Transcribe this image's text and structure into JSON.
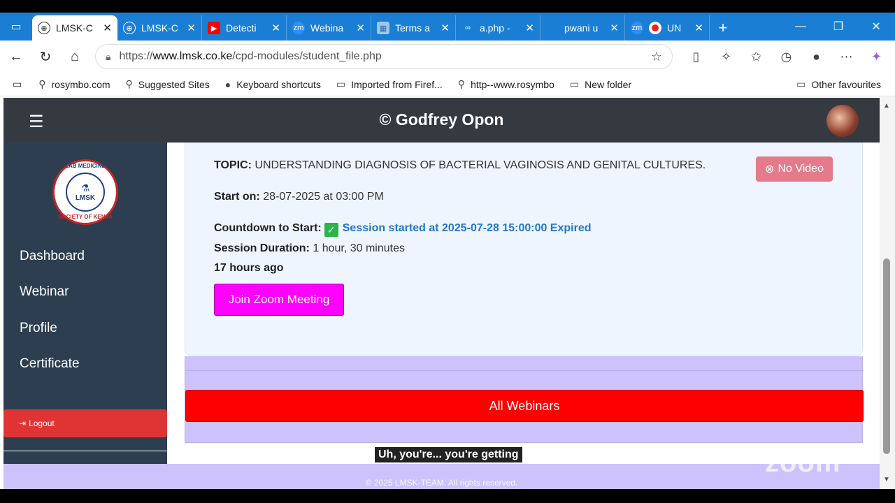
{
  "browser": {
    "tabs": [
      {
        "title": "LMSK-C",
        "active": true
      },
      {
        "title": "LMSK-C"
      },
      {
        "title": "Detecti"
      },
      {
        "title": "Webina"
      },
      {
        "title": "Terms a"
      },
      {
        "title": "a.php -"
      },
      {
        "title": "pwani u"
      },
      {
        "title": "UN"
      }
    ],
    "url_prefix": "https://",
    "url_domain": "www.lmsk.co.ke",
    "url_path": "/cpd-modules/student_file.php",
    "favorites": [
      {
        "label": "rosymbo.com",
        "icon": "search-icon"
      },
      {
        "label": "Suggested Sites",
        "icon": "search-icon"
      },
      {
        "label": "Keyboard shortcuts",
        "icon": "github-icon"
      },
      {
        "label": "Imported from Firef...",
        "icon": "folder-icon"
      },
      {
        "label": "http--www.rosymbo",
        "icon": "search-icon"
      },
      {
        "label": "New folder",
        "icon": "folder-icon"
      }
    ],
    "other_favourites": "Other favourites"
  },
  "header": {
    "brand": "© Godfrey Opon"
  },
  "sidebar": {
    "logo_top": "LAB MEDICINE",
    "logo_center": "LMSK",
    "logo_bottom": "SOCIETY OF KENYA",
    "items": [
      "Dashboard",
      "Webinar",
      "Profile",
      "Certificate"
    ],
    "logout": "Logout"
  },
  "session": {
    "topic_label": "TOPIC:",
    "topic": "UNDERSTANDING DIAGNOSIS OF BACTERIAL VAGINOSIS AND GENITAL CULTURES.",
    "start_label": "Start on:",
    "start": "28-07-2025 at 03:00 PM",
    "countdown_label": "Countdown to Start:",
    "countdown_status": "Session started at 2025-07-28 15:00:00 Expired",
    "duration_label": "Session Duration:",
    "duration": "1 hour, 30 minutes",
    "ago": "17 hours ago",
    "no_video": "No Video",
    "join_button": "Join Zoom Meeting"
  },
  "all_webinars": "All Webinars",
  "footer": "© 2025 LMSK-TEAM. All rights reserved.",
  "overlay": {
    "caption": "Uh, you're... you're getting",
    "watermark": "zoom"
  },
  "colors": {
    "header_bg": "#343a40",
    "sidebar_bg": "#2c3e50",
    "join_button": "#ff00ff",
    "all_webinars": "#ff0000",
    "no_video": "#e57a8a",
    "status_blue": "#1f78c8",
    "lavender": "#cdc2fb"
  }
}
